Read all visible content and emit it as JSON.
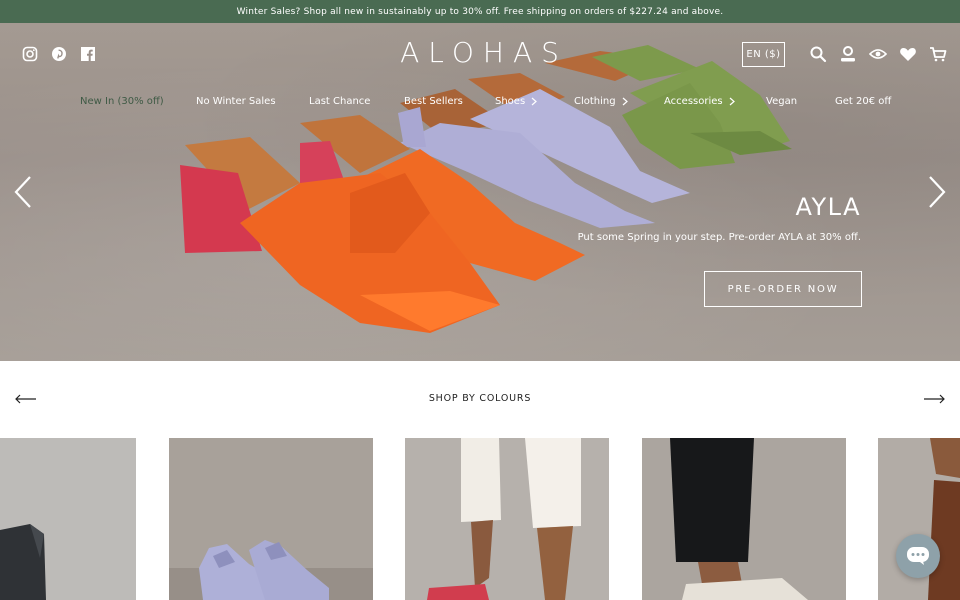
{
  "announcement": "Winter Sales? Shop all new in sustainably up to 30% off. Free shipping on orders of $227.24 and above.",
  "brand": {
    "logo": "ALOHAS"
  },
  "social_icons": [
    "instagram-icon",
    "pinterest-icon",
    "facebook-icon"
  ],
  "header": {
    "language": "EN ($)",
    "icons": [
      "search-icon",
      "account-icon",
      "eye-icon",
      "wishlist-heart-icon",
      "cart-icon"
    ]
  },
  "nav": {
    "items": [
      {
        "label": "New In (30% off)",
        "has_submenu": false
      },
      {
        "label": "No Winter Sales",
        "has_submenu": false
      },
      {
        "label": "Last Chance",
        "has_submenu": false
      },
      {
        "label": "Best Sellers",
        "has_submenu": false
      },
      {
        "label": "Shoes",
        "has_submenu": true
      },
      {
        "label": "Clothing",
        "has_submenu": true
      },
      {
        "label": "Accessories",
        "has_submenu": true
      },
      {
        "label": "Vegan",
        "has_submenu": false
      },
      {
        "label": "Get 20€ off",
        "has_submenu": false
      }
    ]
  },
  "hero": {
    "title": "AYLA",
    "subtitle": "Put some Spring in your step. Pre-order AYLA at 30% off.",
    "cta": "PRE-ORDER NOW",
    "colors": [
      "#e8611f",
      "#b7b5dc",
      "#7d9a4c"
    ]
  },
  "shop_by_colours": {
    "title": "SHOP BY COLOURS"
  },
  "colors": {
    "announcement_bg": "#4a6b52",
    "chat_button": "#8ea1a9"
  }
}
